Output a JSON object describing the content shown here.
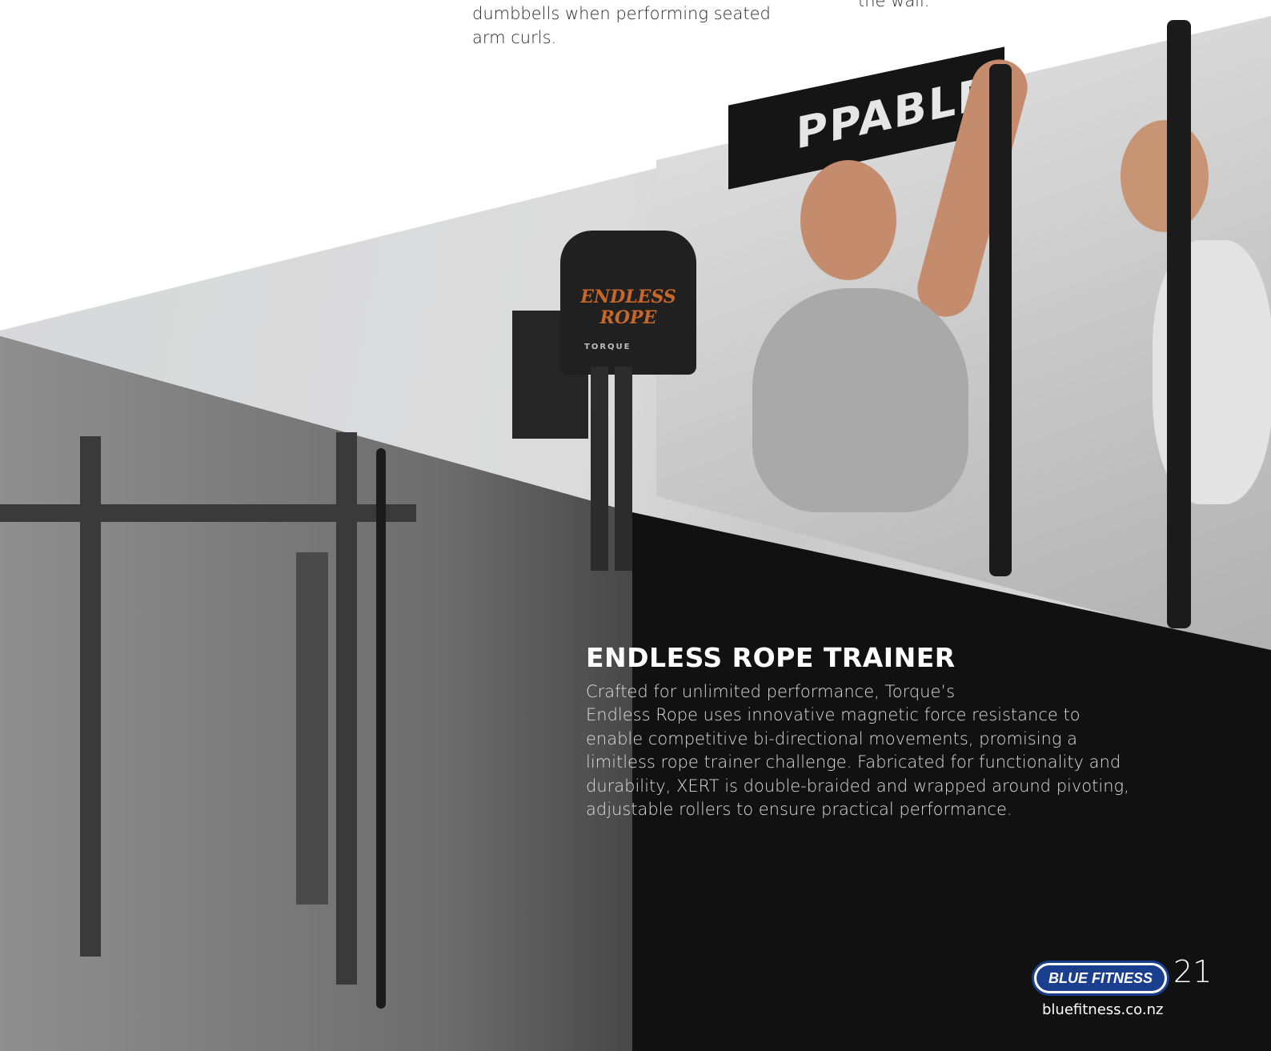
{
  "top_left_text": [
    "dumbbells when performing seated",
    "arm curls."
  ],
  "top_right_text": "the wall.",
  "banner_text": "PPABLE",
  "product": {
    "logo_lines": [
      "ENDLESS",
      "ROPE"
    ],
    "brand": "TORQUE"
  },
  "section": {
    "title": "ENDLESS ROPE TRAINER",
    "description_lines": [
      "Crafted for unlimited performance, Torque’s",
      "Endless Rope uses innovative magnetic force resistance to",
      "enable competitive bi-directional movements, promising a",
      "limitless rope trainer challenge. Fabricated for functionality and",
      "durability, XERT is double-braided and wrapped around pivoting,",
      "adjustable rollers to ensure practical performance."
    ]
  },
  "footer": {
    "logo_text": "BLUE FITNESS",
    "page_number": "21",
    "url": "bluefitness.co.nz"
  },
  "colors": {
    "brand_blue": "#1b3f8f",
    "dark_panel": "#111111",
    "accent_orange": "#c8672a"
  }
}
